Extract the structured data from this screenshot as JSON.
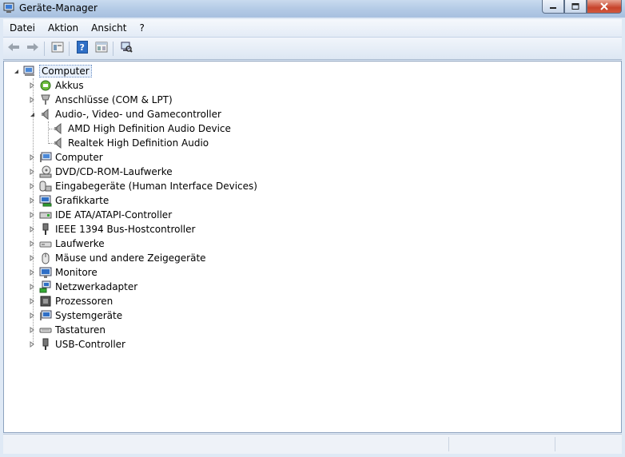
{
  "window": {
    "title": "Geräte-Manager"
  },
  "menu": [
    "Datei",
    "Aktion",
    "Ansicht",
    "?"
  ],
  "toolbar": {
    "buttons": [
      "back-icon",
      "forward-icon",
      "properties-icon",
      "help-icon",
      "view-icon",
      "scan-hardware-icon"
    ]
  },
  "tree": {
    "root": "Computer",
    "items": [
      {
        "label": "Akkus",
        "icon": "battery-icon",
        "expanded": false
      },
      {
        "label": "Anschlüsse (COM & LPT)",
        "icon": "port-icon",
        "expanded": false
      },
      {
        "label": "Audio-, Video- und Gamecontroller",
        "icon": "speaker-icon",
        "expanded": true,
        "children": [
          "AMD High Definition Audio Device",
          "Realtek High Definition Audio"
        ]
      },
      {
        "label": "Computer",
        "icon": "computer-icon",
        "expanded": false
      },
      {
        "label": "DVD/CD-ROM-Laufwerke",
        "icon": "dvd-drive-icon",
        "expanded": false
      },
      {
        "label": "Eingabegeräte (Human Interface Devices)",
        "icon": "hid-icon",
        "expanded": false
      },
      {
        "label": "Grafikkarte",
        "icon": "display-adapter-icon",
        "expanded": false
      },
      {
        "label": "IDE ATA/ATAPI-Controller",
        "icon": "ide-controller-icon",
        "expanded": false
      },
      {
        "label": "IEEE 1394 Bus-Hostcontroller",
        "icon": "firewire-icon",
        "expanded": false
      },
      {
        "label": "Laufwerke",
        "icon": "disk-drive-icon",
        "expanded": false
      },
      {
        "label": "Mäuse und andere Zeigegeräte",
        "icon": "mouse-icon",
        "expanded": false
      },
      {
        "label": "Monitore",
        "icon": "monitor-icon",
        "expanded": false
      },
      {
        "label": "Netzwerkadapter",
        "icon": "network-adapter-icon",
        "expanded": false
      },
      {
        "label": "Prozessoren",
        "icon": "processor-icon",
        "expanded": false
      },
      {
        "label": "Systemgeräte",
        "icon": "system-devices-icon",
        "expanded": false
      },
      {
        "label": "Tastaturen",
        "icon": "keyboard-icon",
        "expanded": false
      },
      {
        "label": "USB-Controller",
        "icon": "usb-icon",
        "expanded": false
      }
    ]
  }
}
